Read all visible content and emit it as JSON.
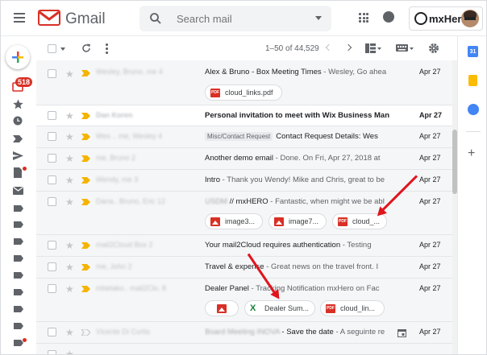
{
  "app": {
    "name": "Gmail",
    "account_brand": "mxHero"
  },
  "search": {
    "placeholder": "Search mail"
  },
  "sidebar": {
    "inbox_count": "518"
  },
  "toolbar": {
    "pagination": "1–50 of 44,529"
  },
  "colors": {
    "accent_red": "#d93025",
    "important_yellow": "#f4b400",
    "arrow_red": "#e0141d"
  },
  "rows": [
    {
      "sender": "Wesley, Bruno, me 4",
      "subject": "Alex & Bruno - Box Meeting Times",
      "snippet": " - Wesley, Go ahea",
      "date": "Apr 27",
      "unread": false,
      "attachments": [
        {
          "type": "pdf",
          "name": "cloud_links.pdf"
        }
      ]
    },
    {
      "sender": "Dan Koren",
      "subject": "Personal invitation to meet with Wix Business Man",
      "snippet": "",
      "date": "Apr 27",
      "unread": true
    },
    {
      "sender": "Wes .. me, Wesley 4",
      "label": "Misc/Contact Request",
      "subject": "Contact Request Details: Wes",
      "snippet": "",
      "date": "Apr 27",
      "unread": false
    },
    {
      "sender": "me, Bruno 2",
      "subject": "Another demo email",
      "snippet": " - Done. On Fri, Apr 27, 2018 at",
      "date": "Apr 27",
      "unread": false
    },
    {
      "sender": "Wendy, me 3",
      "subject": "Intro",
      "snippet": " - Thank you Wendy! Mike and Chris, great to be",
      "date": "Apr 27",
      "unread": false
    },
    {
      "sender": "Dana.. Bruno, Eric 12",
      "subject_prefix": "USDM",
      "subject": " // mxHERO",
      "snippet": " - Fantastic, when might we be abl",
      "date": "Apr 27",
      "unread": false,
      "attachments": [
        {
          "type": "img",
          "name": "image3..."
        },
        {
          "type": "img",
          "name": "image7..."
        },
        {
          "type": "pdf",
          "name": "cloud_..."
        }
      ]
    },
    {
      "sender": "mail2Cloud Box 2",
      "subject": "Your mail2Cloud requires authentication",
      "snippet": " - Testing",
      "date": "Apr 27",
      "unread": false
    },
    {
      "sender": "me, John 2",
      "subject": "Travel & expense",
      "snippet": " - Great news on the travel front. I",
      "date": "Apr 27",
      "unread": false
    },
    {
      "sender": "mbetako.. mail2Clo. 8",
      "subject": "Dealer Panel",
      "snippet": " - Tracking Notification mxHero on Fac",
      "date": "Apr 27",
      "unread": false,
      "attachments": [
        {
          "type": "img",
          "name": ""
        },
        {
          "type": "xls",
          "name": "Dealer Sum..."
        },
        {
          "type": "pdf",
          "name": "cloud_lin..."
        }
      ]
    },
    {
      "sender": "Vicente Di Curtis",
      "subject_prefix": "Board Meeting INOVA",
      "subject": " - Save the date",
      "snippet": " - A seguinte re",
      "date": "Apr 27",
      "unread": false
    }
  ],
  "icons": {
    "menu": "hamburger-icon",
    "search": "search-icon",
    "apps": "apps-grid-icon",
    "notifications": "bell-icon",
    "settings": "gear-icon",
    "refresh": "refresh-icon",
    "more": "more-vert-icon",
    "calendar": "calendar-icon",
    "keep": "keep-icon",
    "tasks": "tasks-icon",
    "add": "plus-icon"
  }
}
